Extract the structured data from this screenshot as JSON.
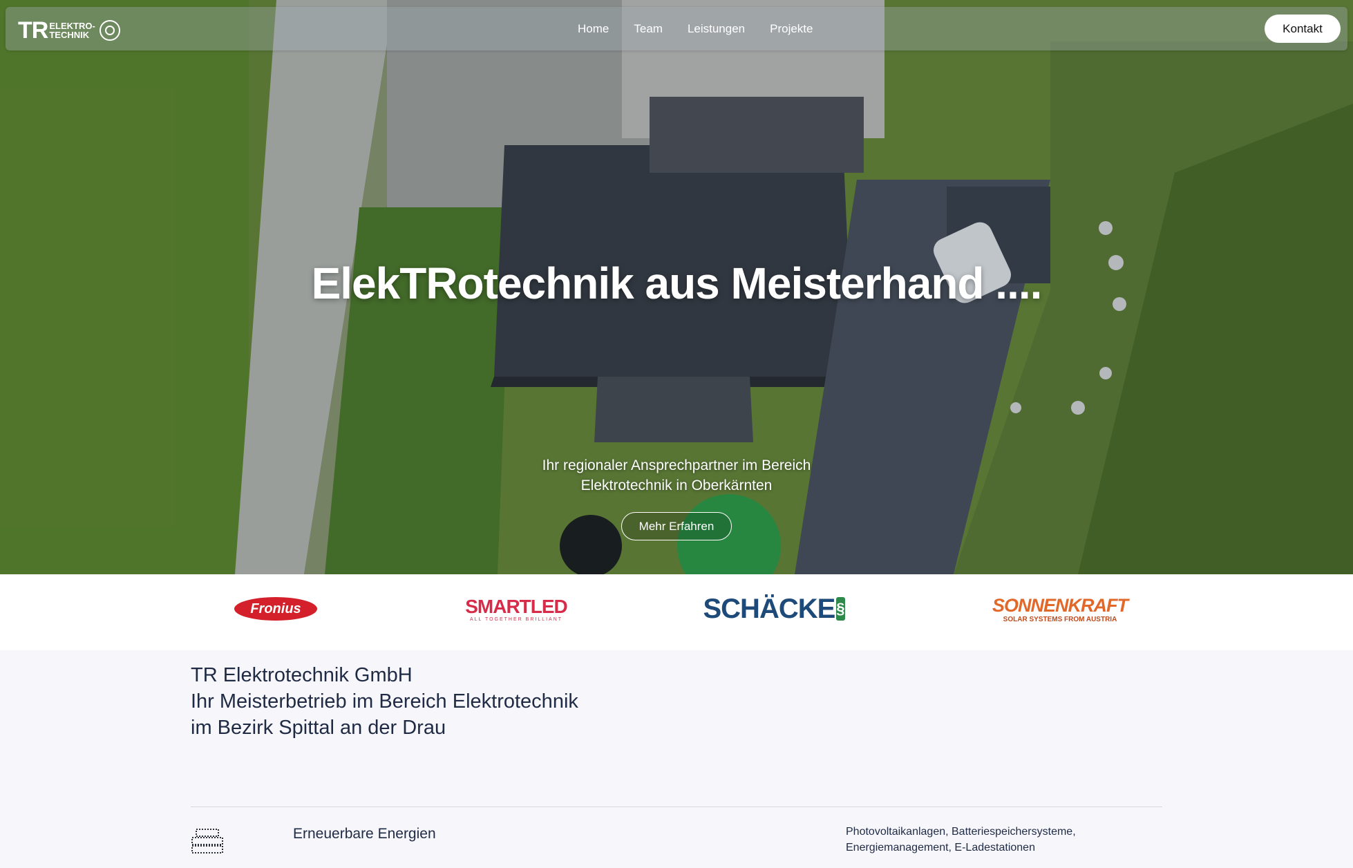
{
  "nav": {
    "logo": {
      "mark": "TR",
      "line1": "ELEKTRO-",
      "line2": "TECHNIK"
    },
    "links": [
      "Home",
      "Team",
      "Leistungen",
      "Projekte"
    ],
    "contact_label": "Kontakt"
  },
  "hero": {
    "title": "ElekTRotechnik aus Meisterhand ....",
    "subtitle": "Ihr regionaler Ansprechpartner im Bereich Elektrotechnik in Oberkärnten",
    "button_label": "Mehr Erfahren"
  },
  "partners": {
    "fronius": "Fronius",
    "smartled": {
      "name": "SMARTLED",
      "tagline": "ALL TOGETHER BRILLIANT"
    },
    "schaecke": "SCHÄCKE",
    "sonnenkraft": {
      "name": "SONNENKRAFT",
      "tagline": "SOLAR SYSTEMS FROM AUSTRIA"
    }
  },
  "intro": {
    "line1": "TR Elektrotechnik GmbH",
    "line2": "Ihr Meisterbetrieb im Bereich Elektrotechnik",
    "line3": "im Bezirk Spittal an der Drau"
  },
  "services": [
    {
      "icon": "solar-panel-icon",
      "title": "Erneuerbare Energien",
      "description": "Photovoltaikanlagen, Batteriespeichersysteme, Energiemanagement, E-Ladestationen"
    }
  ],
  "colors": {
    "page_bg": "#f7f7fb",
    "text_dark": "#1f2a44",
    "fronius_red": "#d4202a",
    "smartled_red": "#d62c4a",
    "schaecke_blue": "#1e4a7a",
    "sonnenkraft_orange": "#e2682a"
  }
}
